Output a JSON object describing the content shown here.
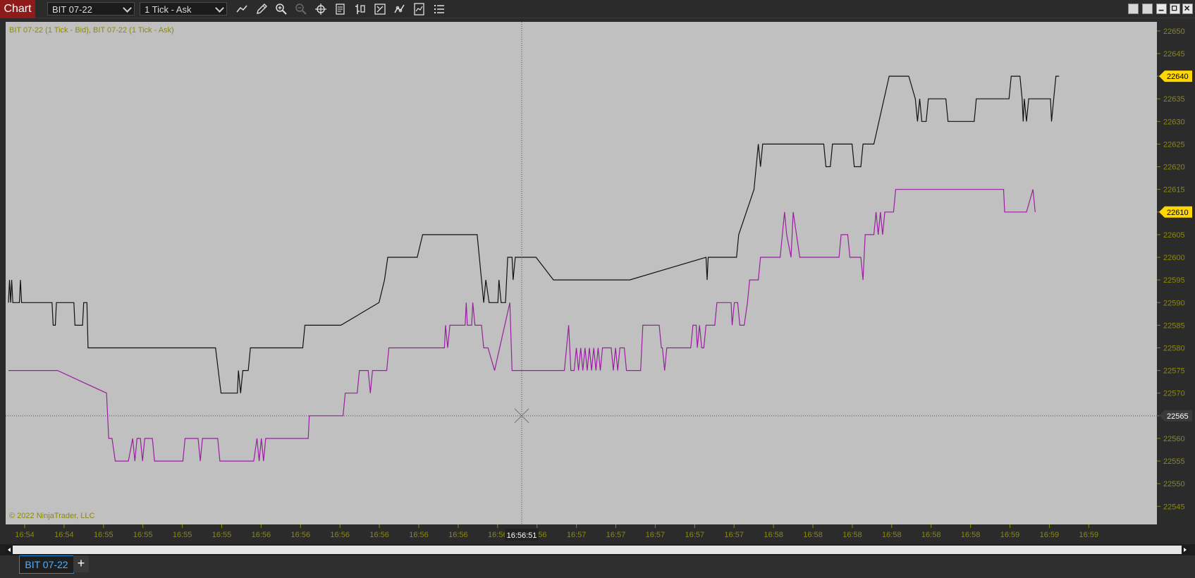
{
  "toolbar": {
    "app_title": "Chart",
    "instrument": "BIT 07-22",
    "interval": "1 Tick - Ask",
    "tools": [
      "line-tool-icon",
      "pencil-icon",
      "zoom-in-icon",
      "zoom-out-icon",
      "crosshair-icon",
      "data-box-icon",
      "bar-type-icon",
      "properties-icon",
      "strategy-icon",
      "list-icon"
    ]
  },
  "chart": {
    "series_label": "BIT 07-22 (1 Tick - Bid), BIT 07-22 (1 Tick - Ask)",
    "copyright": "© 2022 NinjaTrader, LLC",
    "crosshair_time": "16:56:51",
    "crosshair_price": "22565",
    "bg_color": "#c0c0c0",
    "label_color": "#8b8b00"
  },
  "chart_data": {
    "type": "line",
    "ylim": [
      22541,
      22652
    ],
    "y_ticks": [
      22545,
      22550,
      22555,
      22560,
      22565,
      22570,
      22575,
      22580,
      22585,
      22590,
      22595,
      22600,
      22605,
      22610,
      22615,
      22620,
      22625,
      22630,
      22635,
      22640,
      22645,
      22650
    ],
    "x_ticks": [
      "16:54",
      "16:54",
      "16:55",
      "16:55",
      "16:55",
      "16:55",
      "16:56",
      "16:56",
      "16:56",
      "16:56",
      "16:56",
      "16:56",
      "16:56",
      "16:56",
      "16:57",
      "16:57",
      "16:57",
      "16:57",
      "16:57",
      "16:58",
      "16:58",
      "16:58",
      "16:58",
      "16:58",
      "16:58",
      "16:59",
      "16:59",
      "16:59"
    ],
    "series": [
      {
        "color": "#111111",
        "last_value": "22640",
        "last_color": "#ffd700",
        "points": [
          [
            0,
            22590
          ],
          [
            1,
            22595
          ],
          [
            2,
            22590
          ],
          [
            3,
            22595
          ],
          [
            4,
            22590
          ],
          [
            10,
            22590
          ],
          [
            11,
            22595
          ],
          [
            12,
            22590
          ],
          [
            20,
            22590
          ],
          [
            40,
            22590
          ],
          [
            41,
            22585
          ],
          [
            43,
            22585
          ],
          [
            44,
            22590
          ],
          [
            60,
            22590
          ],
          [
            61,
            22585
          ],
          [
            68,
            22585
          ],
          [
            69,
            22590
          ],
          [
            72,
            22590
          ],
          [
            73,
            22580
          ],
          [
            190,
            22580
          ],
          [
            195,
            22570
          ],
          [
            210,
            22570
          ],
          [
            211,
            22575
          ],
          [
            213,
            22570
          ],
          [
            215,
            22575
          ],
          [
            220,
            22575
          ],
          [
            222,
            22580
          ],
          [
            270,
            22580
          ],
          [
            272,
            22585
          ],
          [
            305,
            22585
          ],
          [
            340,
            22590
          ],
          [
            345,
            22595
          ],
          [
            348,
            22600
          ],
          [
            375,
            22600
          ],
          [
            380,
            22605
          ],
          [
            430,
            22605
          ],
          [
            432,
            22600
          ],
          [
            436,
            22590
          ],
          [
            438,
            22595
          ],
          [
            441,
            22590
          ],
          [
            449,
            22590
          ],
          [
            450,
            22595
          ],
          [
            452,
            22590
          ],
          [
            456,
            22590
          ],
          [
            458,
            22600
          ],
          [
            462,
            22600
          ],
          [
            463,
            22595
          ],
          [
            465,
            22600
          ],
          [
            484,
            22600
          ],
          [
            500,
            22595
          ],
          [
            570,
            22595
          ],
          [
            640,
            22600
          ],
          [
            641,
            22595
          ],
          [
            642,
            22600
          ],
          [
            668,
            22600
          ],
          [
            670,
            22605
          ],
          [
            684,
            22615
          ],
          [
            688,
            22625
          ],
          [
            690,
            22620
          ],
          [
            692,
            22625
          ],
          [
            748,
            22625
          ],
          [
            750,
            22620
          ],
          [
            754,
            22620
          ],
          [
            756,
            22625
          ],
          [
            774,
            22625
          ],
          [
            776,
            22620
          ],
          [
            782,
            22620
          ],
          [
            784,
            22625
          ],
          [
            794,
            22625
          ],
          [
            808,
            22640
          ],
          [
            826,
            22640
          ],
          [
            832,
            22635
          ],
          [
            834,
            22630
          ],
          [
            836,
            22635
          ],
          [
            838,
            22630
          ],
          [
            842,
            22630
          ],
          [
            844,
            22635
          ],
          [
            860,
            22635
          ],
          [
            862,
            22630
          ],
          [
            886,
            22630
          ],
          [
            888,
            22635
          ],
          [
            918,
            22635
          ],
          [
            920,
            22640
          ],
          [
            928,
            22640
          ],
          [
            930,
            22635
          ],
          [
            931,
            22630
          ],
          [
            932,
            22635
          ],
          [
            934,
            22630
          ],
          [
            936,
            22635
          ],
          [
            956,
            22635
          ],
          [
            957,
            22630
          ],
          [
            959,
            22635
          ],
          [
            961,
            22640
          ],
          [
            964,
            22640
          ]
        ]
      },
      {
        "color": "#9a1fa0",
        "last_value": "22610",
        "last_color": "#ffd700",
        "points": [
          [
            0,
            22575
          ],
          [
            45,
            22575
          ],
          [
            90,
            22570
          ],
          [
            92,
            22560
          ],
          [
            95,
            22560
          ],
          [
            98,
            22555
          ],
          [
            110,
            22555
          ],
          [
            114,
            22560
          ],
          [
            116,
            22555
          ],
          [
            118,
            22560
          ],
          [
            121,
            22560
          ],
          [
            123,
            22555
          ],
          [
            125,
            22560
          ],
          [
            132,
            22560
          ],
          [
            134,
            22555
          ],
          [
            160,
            22555
          ],
          [
            162,
            22560
          ],
          [
            174,
            22560
          ],
          [
            176,
            22555
          ],
          [
            178,
            22560
          ],
          [
            192,
            22560
          ],
          [
            194,
            22555
          ],
          [
            225,
            22555
          ],
          [
            228,
            22560
          ],
          [
            230,
            22555
          ],
          [
            232,
            22560
          ],
          [
            234,
            22555
          ],
          [
            236,
            22560
          ],
          [
            275,
            22560
          ],
          [
            276,
            22565
          ],
          [
            307,
            22565
          ],
          [
            309,
            22570
          ],
          [
            320,
            22570
          ],
          [
            322,
            22575
          ],
          [
            330,
            22575
          ],
          [
            332,
            22570
          ],
          [
            334,
            22575
          ],
          [
            347,
            22575
          ],
          [
            349,
            22580
          ],
          [
            400,
            22580
          ],
          [
            401,
            22585
          ],
          [
            403,
            22580
          ],
          [
            405,
            22585
          ],
          [
            419,
            22585
          ],
          [
            420,
            22590
          ],
          [
            421,
            22585
          ],
          [
            425,
            22585
          ],
          [
            426,
            22590
          ],
          [
            428,
            22585
          ],
          [
            434,
            22585
          ],
          [
            436,
            22580
          ],
          [
            440,
            22580
          ],
          [
            446,
            22575
          ],
          [
            460,
            22590
          ],
          [
            462,
            22575
          ],
          [
            510,
            22575
          ],
          [
            512,
            22580
          ],
          [
            514,
            22585
          ],
          [
            516,
            22575
          ],
          [
            519,
            22575
          ],
          [
            521,
            22580
          ],
          [
            523,
            22575
          ],
          [
            525,
            22580
          ],
          [
            527,
            22575
          ],
          [
            529,
            22580
          ],
          [
            531,
            22575
          ],
          [
            533,
            22580
          ],
          [
            535,
            22575
          ],
          [
            537,
            22580
          ],
          [
            539,
            22575
          ],
          [
            541,
            22580
          ],
          [
            543,
            22575
          ],
          [
            545,
            22580
          ],
          [
            553,
            22580
          ],
          [
            555,
            22575
          ],
          [
            557,
            22580
          ],
          [
            559,
            22575
          ],
          [
            561,
            22580
          ],
          [
            565,
            22580
          ],
          [
            567,
            22575
          ],
          [
            580,
            22575
          ],
          [
            582,
            22585
          ],
          [
            597,
            22585
          ],
          [
            599,
            22580
          ],
          [
            600,
            22580
          ],
          [
            602,
            22575
          ],
          [
            604,
            22580
          ],
          [
            626,
            22580
          ],
          [
            628,
            22585
          ],
          [
            631,
            22585
          ],
          [
            632,
            22580
          ],
          [
            634,
            22585
          ],
          [
            636,
            22580
          ],
          [
            638,
            22580
          ],
          [
            640,
            22585
          ],
          [
            648,
            22585
          ],
          [
            650,
            22590
          ],
          [
            663,
            22590
          ],
          [
            664,
            22585
          ],
          [
            666,
            22590
          ],
          [
            669,
            22590
          ],
          [
            671,
            22585
          ],
          [
            675,
            22585
          ],
          [
            678,
            22590
          ],
          [
            680,
            22595
          ],
          [
            688,
            22595
          ],
          [
            690,
            22600
          ],
          [
            708,
            22600
          ],
          [
            710,
            22605
          ],
          [
            712,
            22610
          ],
          [
            714,
            22605
          ],
          [
            718,
            22600
          ],
          [
            720,
            22610
          ],
          [
            726,
            22600
          ],
          [
            762,
            22600
          ],
          [
            764,
            22605
          ],
          [
            770,
            22605
          ],
          [
            772,
            22600
          ],
          [
            782,
            22600
          ],
          [
            784,
            22595
          ],
          [
            786,
            22605
          ],
          [
            794,
            22605
          ],
          [
            796,
            22610
          ],
          [
            798,
            22605
          ],
          [
            800,
            22610
          ],
          [
            802,
            22605
          ],
          [
            804,
            22610
          ],
          [
            812,
            22610
          ],
          [
            814,
            22615
          ],
          [
            913,
            22615
          ],
          [
            914,
            22610
          ],
          [
            934,
            22610
          ],
          [
            940,
            22615
          ],
          [
            942,
            22610
          ]
        ]
      }
    ]
  },
  "tabs": [
    {
      "label": "BIT 07-22"
    }
  ],
  "tab_add": "+"
}
